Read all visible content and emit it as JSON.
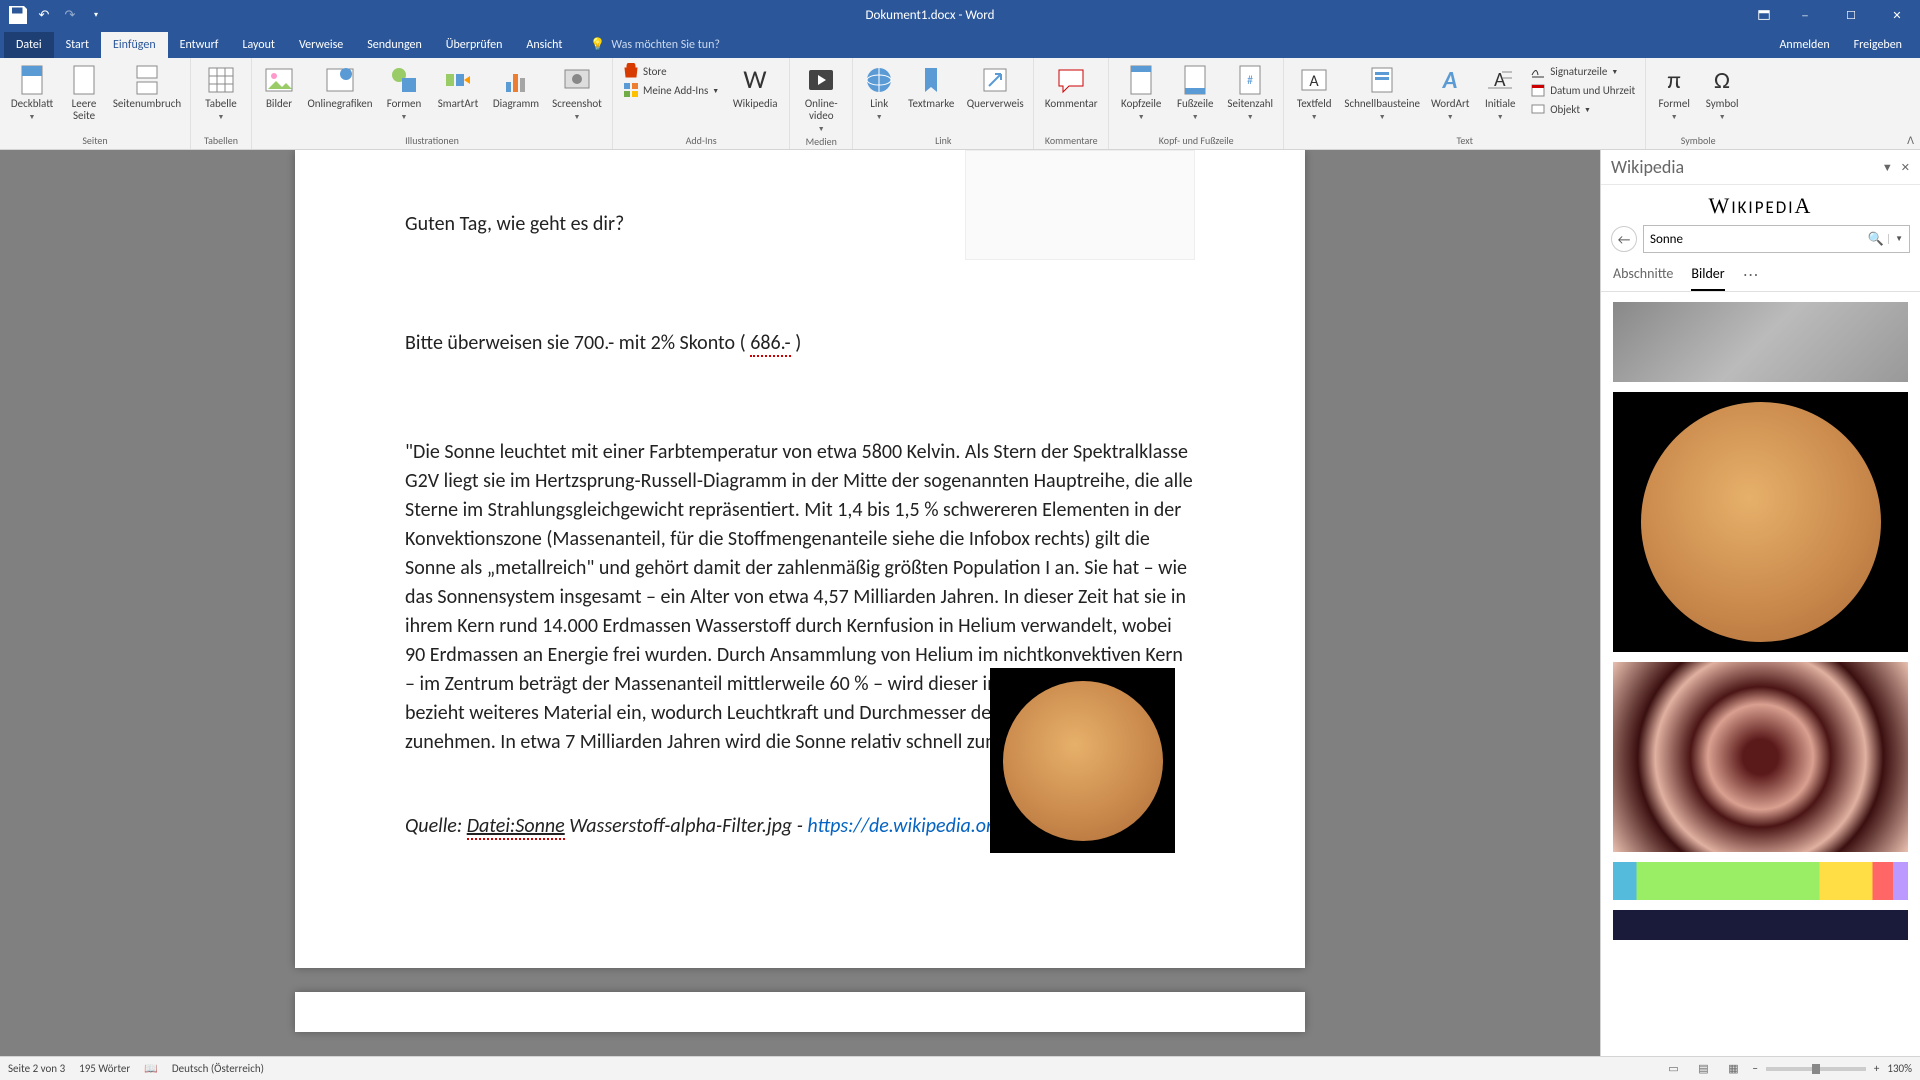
{
  "title_bar": {
    "document_title": "Dokument1.docx - Word"
  },
  "tabs": {
    "file": "Datei",
    "start": "Start",
    "einfuegen": "Einfügen",
    "entwurf": "Entwurf",
    "layout": "Layout",
    "verweise": "Verweise",
    "sendungen": "Sendungen",
    "ueberpruefen": "Überprüfen",
    "ansicht": "Ansicht",
    "tell_me_placeholder": "Was möchten Sie tun?",
    "anmelden": "Anmelden",
    "freigeben": "Freigeben"
  },
  "ribbon": {
    "seiten": {
      "label": "Seiten",
      "deckblatt": "Deckblatt",
      "leere_seite": "Leere Seite",
      "seitenumbruch": "Seitenumbruch"
    },
    "tabellen": {
      "label": "Tabellen",
      "tabelle": "Tabelle"
    },
    "illustrationen": {
      "label": "Illustrationen",
      "bilder": "Bilder",
      "onlinegrafiken": "Onlinegrafiken",
      "formen": "Formen",
      "smartart": "SmartArt",
      "diagramm": "Diagramm",
      "screenshot": "Screenshot"
    },
    "addins": {
      "label": "Add-Ins",
      "store": "Store",
      "meine_addins": "Meine Add-Ins",
      "wikipedia": "Wikipedia"
    },
    "medien": {
      "label": "Medien",
      "onlinevideo": "Online-video"
    },
    "link": {
      "label": "Link",
      "link": "Link",
      "textmarke": "Textmarke",
      "querverweis": "Querverweis"
    },
    "kommentare": {
      "label": "Kommentare",
      "kommentar": "Kommentar"
    },
    "kopf": {
      "label": "Kopf- und Fußzeile",
      "kopfzeile": "Kopfzeile",
      "fusszeile": "Fußzeile",
      "seitenzahl": "Seitenzahl"
    },
    "text": {
      "label": "Text",
      "textfeld": "Textfeld",
      "schnellbausteine": "Schnellbausteine",
      "wordart": "WordArt",
      "initiale": "Initiale",
      "signaturzeile": "Signaturzeile",
      "datum": "Datum und Uhrzeit",
      "objekt": "Objekt"
    },
    "symbole": {
      "label": "Symbole",
      "formel": "Formel",
      "symbol": "Symbol"
    }
  },
  "document": {
    "greeting": "Guten Tag, wie geht es dir?",
    "invoice_pre": "Bitte überweisen sie 700.- mit 2% Skonto ",
    "invoice_paren_open": "( ",
    "invoice_amount": "686.-",
    "invoice_paren_close": " )",
    "quote": "\"Die Sonne leuchtet mit einer Farbtemperatur von etwa 5800 Kelvin. Als Stern der Spektralklasse G2V liegt sie im Hertzsprung-Russell-Diagramm in der Mitte der sogenannten Hauptreihe, die alle Sterne im Strahlungsgleichgewicht repräsentiert. Mit 1,4 bis 1,5 % schwereren Elementen in der Konvektionszone (Massenanteil, für die Stoffmengenanteile siehe die Infobox rechts) gilt die Sonne als „metallreich\" und gehört damit der zahlenmäßig größten Population I an. Sie hat – wie das Sonnensystem insgesamt – ein Alter von etwa 4,57 Milliarden Jahren. In dieser Zeit hat sie in ihrem Kern rund 14.000 Erdmassen Wasserstoff durch Kernfusion in Helium verwandelt, wobei 90 Erdmassen an Energie frei wurden. Durch Ansammlung von Helium im nichtkonvektiven Kern – im Zentrum beträgt der Massenanteil mittlerweile 60 % – wird dieser immer kompakter und bezieht weiteres Material ein, wodurch Leuchtkraft und Durchmesser der Sonne langsam zunehmen. In etwa 7 Milliarden Jahren wird die Sonne relativ schnell zum Roten Riesen.\"",
    "source_pre": "Quelle: ",
    "source_file": "Datei:Sonne",
    "source_mid": " Wasserstoff-alpha-Filter.jpg - ",
    "source_link": "https://de.wikipedia.org"
  },
  "wiki": {
    "pane_title": "Wikipedia",
    "logo": "WIKIPEDIA",
    "search_value": "Sonne",
    "tab_sections": "Abschnitte",
    "tab_images": "Bilder"
  },
  "status": {
    "page": "Seite 2 von 3",
    "words": "195 Wörter",
    "language": "Deutsch (Österreich)",
    "zoom": "130%"
  }
}
